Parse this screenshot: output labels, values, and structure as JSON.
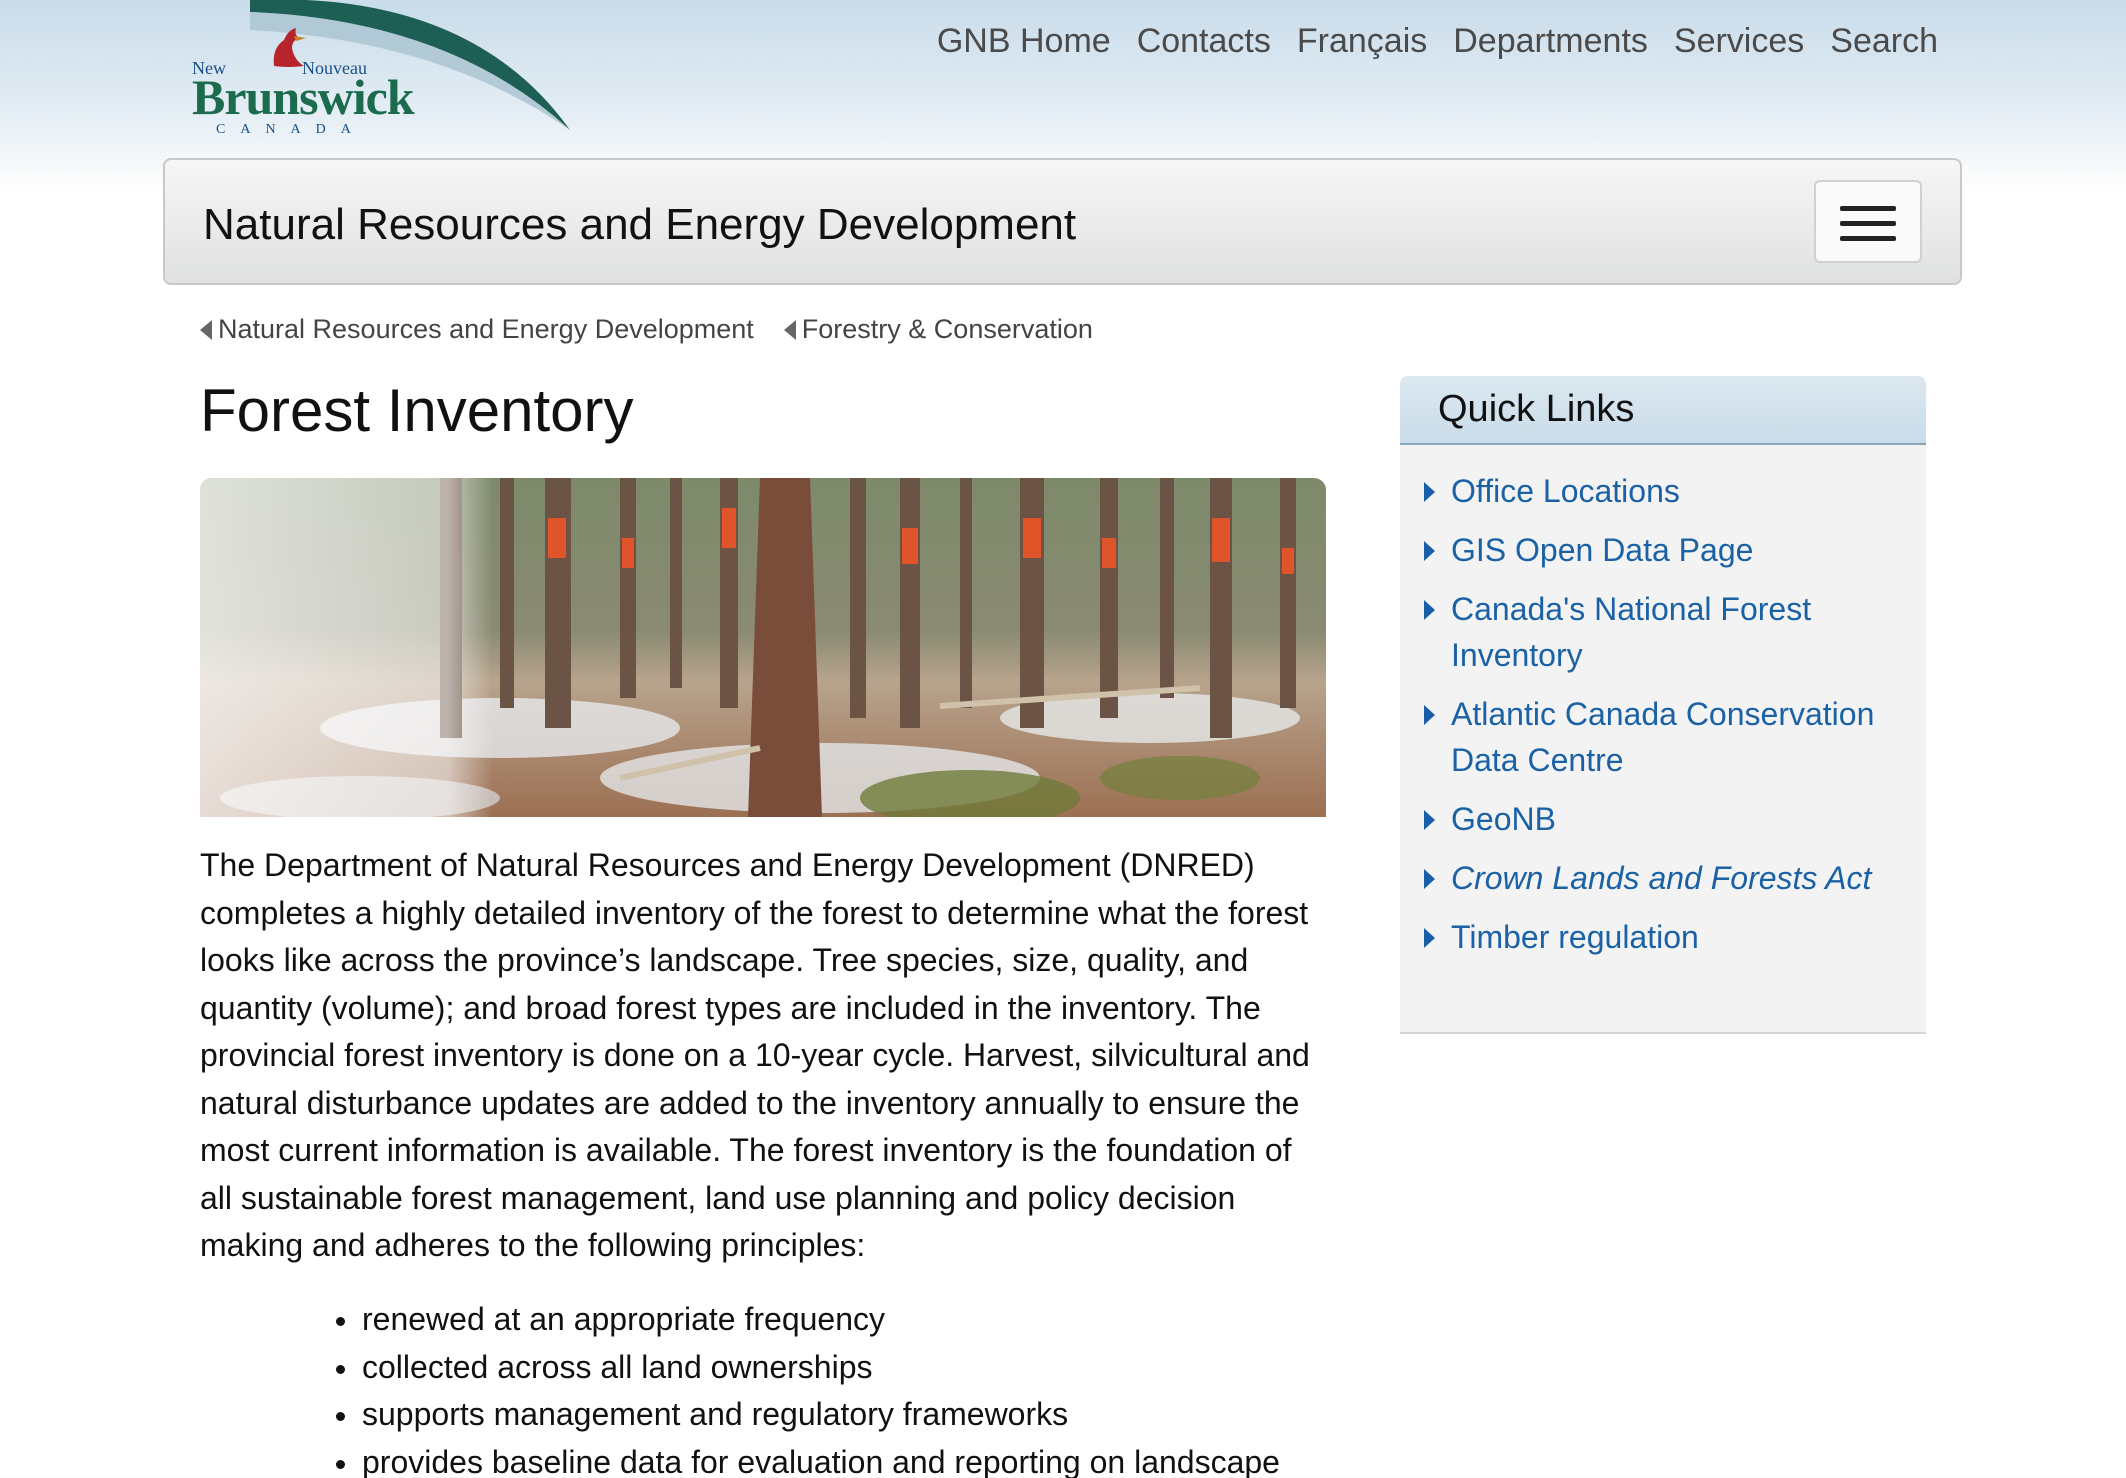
{
  "header": {
    "logo": {
      "new": "New",
      "nouveau": "Nouveau",
      "brand": "Brunswick",
      "country": "CANADA"
    },
    "nav": [
      "GNB Home",
      "Contacts",
      "Français",
      "Departments",
      "Services",
      "Search"
    ]
  },
  "department": {
    "title": "Natural Resources and Energy Development"
  },
  "breadcrumb": [
    "Natural Resources and Energy Development",
    "Forestry & Conservation"
  ],
  "main": {
    "title": "Forest Inventory",
    "intro": "The Department of Natural Resources and Energy Development (DNRED) completes a highly detailed inventory of the forest to determine what the forest looks like across the province’s landscape. Tree species, size, quality, and quantity (volume); and broad forest types are included in the inventory. The provincial forest inventory is done on a 10-year cycle. Harvest, silvicultural and natural disturbance updates are added to the inventory annually to ensure the most current information is available. The forest inventory is the foundation of all sustainable forest management, land use planning and policy decision making and adheres to the following principles:",
    "principles": [
      "renewed at an appropriate frequency",
      "collected across all land ownerships",
      "supports management and regulatory frameworks",
      "provides baseline data for evaluation and reporting on landscape"
    ]
  },
  "quick_links": {
    "title": "Quick Links",
    "items": [
      "Office Locations",
      "GIS Open Data Page",
      "Canada's National Forest Inventory",
      "Atlantic Canada Conservation Data Centre",
      "GeoNB",
      "Crown Lands and Forests Act",
      "Timber regulation"
    ]
  },
  "colors": {
    "link": "#1a61a5",
    "brand_green": "#1d6b4d",
    "brand_blue": "#1a4f86",
    "bird_red": "#b8242c"
  }
}
